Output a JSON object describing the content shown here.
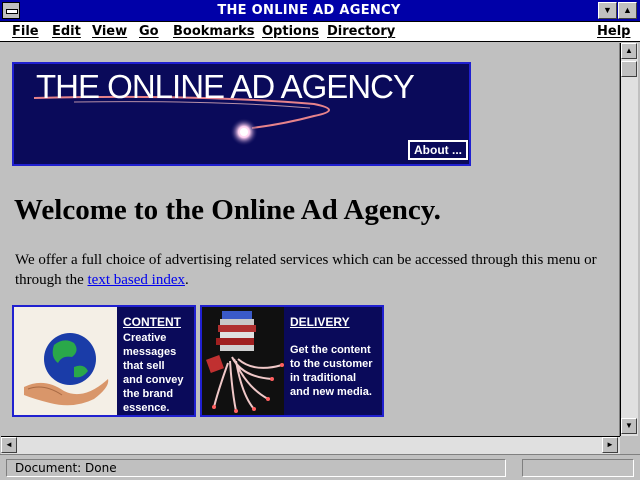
{
  "window": {
    "title": "THE ONLINE AD AGENCY",
    "minimize_glyph": "▼",
    "maximize_glyph": "▲"
  },
  "menu": {
    "items": [
      "File",
      "Edit",
      "View",
      "Go",
      "Bookmarks",
      "Options",
      "Directory"
    ],
    "help": "Help"
  },
  "page": {
    "banner": {
      "title": "THE ONLINE AD AGENCY",
      "about_label": "About ..."
    },
    "heading": "Welcome to the Online Ad Agency.",
    "intro_text": "We offer a full choice of advertising related services which can be accessed through this menu or through the ",
    "intro_link": "text based index",
    "intro_end": ".",
    "tiles": [
      {
        "icon": "globe-in-hand",
        "title": "CONTENT",
        "text": "Creative\nmessages\nthat sell\nand convey\nthe brand\nessence."
      },
      {
        "icon": "books-and-cables",
        "title": "DELIVERY",
        "text": "Get the content\nto the customer\nin traditional\nand new media."
      }
    ]
  },
  "scrollbars": {
    "up_glyph": "▲",
    "down_glyph": "▼",
    "left_glyph": "◄",
    "right_glyph": "►"
  },
  "status": {
    "text": "Document: Done"
  },
  "colors": {
    "titlebar": "#0000a8",
    "page_background": "#c0c0c0",
    "tile_background": "#0a0a5a",
    "tile_border": "#2020d0",
    "link": "#0000ee"
  }
}
